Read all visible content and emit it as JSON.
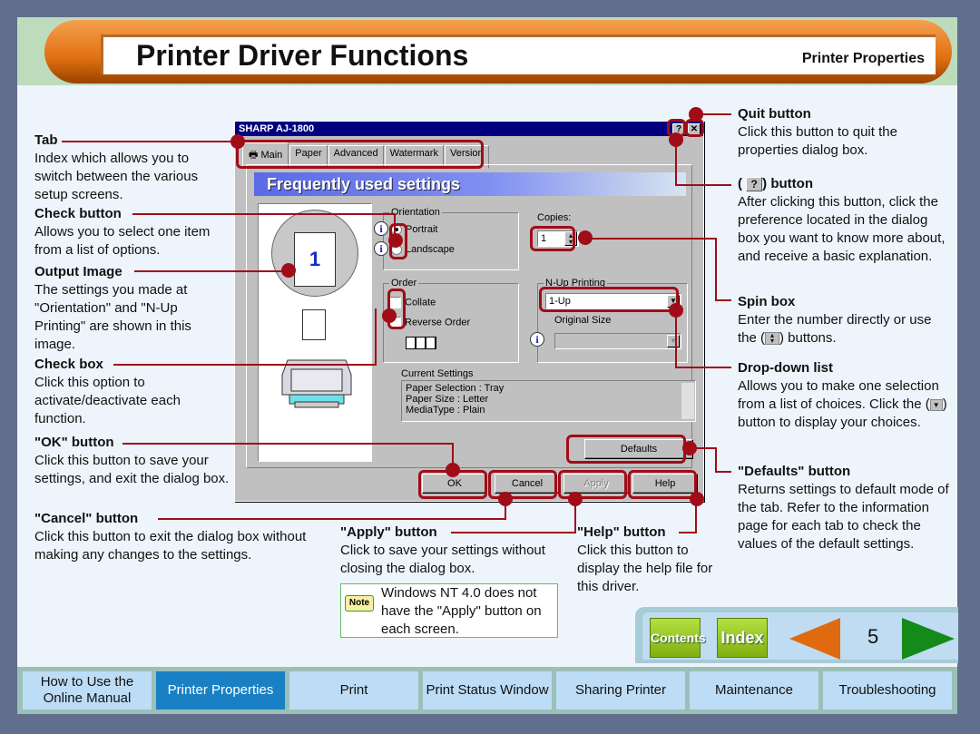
{
  "header": {
    "title": "Printer Driver Functions",
    "section": "Printer Properties"
  },
  "dialog": {
    "title": "SHARP AJ-1800",
    "help_button": "?",
    "close_button": "✕",
    "tabs": [
      {
        "label": "Main",
        "active": true
      },
      {
        "label": "Paper",
        "active": false
      },
      {
        "label": "Advanced",
        "active": false
      },
      {
        "label": "Watermark",
        "active": false
      },
      {
        "label": "Version",
        "active": false
      }
    ],
    "banner": "Frequently used settings",
    "preview_page_number": "1",
    "orientation": {
      "label": "Orientation",
      "options": [
        {
          "label": "Portrait",
          "selected": true
        },
        {
          "label": "Landscape",
          "selected": false
        }
      ]
    },
    "copies": {
      "label": "Copies:",
      "value": "1"
    },
    "order": {
      "label": "Order",
      "options": [
        {
          "label": "Collate",
          "checked": false
        },
        {
          "label": "Reverse Order",
          "checked": false
        }
      ]
    },
    "nup": {
      "label": "N-Up Printing",
      "value": "1-Up",
      "original_size_label": "Original Size",
      "original_size_value": ""
    },
    "current_settings": {
      "label": "Current Settings",
      "lines": [
        "Paper Selection : Tray",
        "Paper Size : Letter",
        "MediaType : Plain"
      ]
    },
    "buttons": {
      "defaults": "Defaults",
      "ok": "OK",
      "cancel": "Cancel",
      "apply": "Apply",
      "help": "Help"
    }
  },
  "annotations": {
    "tab": {
      "title": "Tab",
      "body": "Index which allows you to switch between the various setup screens."
    },
    "check_button": {
      "title": "Check button",
      "body": "Allows you to select one item from a list of options."
    },
    "output_image": {
      "title": "Output Image",
      "body": "The settings you made at \"Orientation\" and \"N-Up Printing\" are shown in this image."
    },
    "check_box": {
      "title": "Check box",
      "body": "Click this option to activate/deactivate each function."
    },
    "ok_button": {
      "title": "\"OK\" button",
      "body": "Click this button to save your settings, and exit the dialog box."
    },
    "cancel_button": {
      "title": "\"Cancel\" button",
      "body": "Click this button to exit the dialog box without making any changes to the settings."
    },
    "apply_button": {
      "title": "\"Apply\" button",
      "body": "Click to save your settings without closing the dialog box."
    },
    "help_button": {
      "title": "\"Help\" button",
      "body": "Click this button to display the help file for this driver."
    },
    "quit_button": {
      "title": "Quit button",
      "body": "Click this button to quit the properties dialog box."
    },
    "question_button": {
      "title_pre": "(",
      "title_icon": "?",
      "title_post": ") button",
      "body": "After clicking this button, click the preference located in the dialog box you want to know more about, and receive a basic explanation."
    },
    "spin_box": {
      "title": "Spin box",
      "body_pre": "Enter the number directly or use the (",
      "body_post": ") buttons."
    },
    "dropdown": {
      "title": "Drop-down list",
      "body_pre": "Allows you to make one selection from a list of choices. Click the (",
      "body_post": ") button to display your choices."
    },
    "defaults_button": {
      "title": "\"Defaults\" button",
      "body": "Returns settings to default mode of the tab. Refer to the information page for each tab to check the values of the default settings."
    }
  },
  "note": {
    "icon_label": "Note",
    "text": "Windows NT 4.0 does not have the \"Apply\" button on each screen."
  },
  "page_nav": {
    "contents": "Contents",
    "index": "Index",
    "page_number": "5"
  },
  "bottom_nav": [
    {
      "label": "How to Use the Online Manual",
      "active": false
    },
    {
      "label": "Printer Properties",
      "active": true
    },
    {
      "label": "Print",
      "active": false
    },
    {
      "label": "Print Status Window",
      "active": false
    },
    {
      "label": "Sharing Printer",
      "active": false
    },
    {
      "label": "Maintenance",
      "active": false
    },
    {
      "label": "Troubleshooting",
      "active": false
    }
  ],
  "colors": {
    "accent_red": "#a00d18",
    "nav_active": "#1a80c4",
    "header_orange": "#e07010"
  }
}
